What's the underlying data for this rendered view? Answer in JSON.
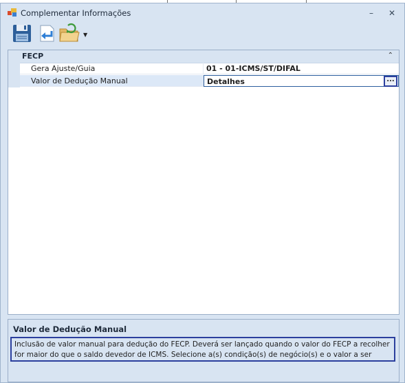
{
  "window": {
    "title": "Complementar Informações",
    "minimize_glyph": "–",
    "close_glyph": "✕"
  },
  "toolbar": {
    "buttons": [
      {
        "icon": "save-icon"
      },
      {
        "icon": "return-icon"
      },
      {
        "icon": "folder-open-icon"
      }
    ],
    "dropdown_glyph": "▼"
  },
  "property_grid": {
    "category": "FECP",
    "collapse_glyph": "⌃",
    "rows": [
      {
        "name": "Gera Ajuste/Guia",
        "value": "01 - 01-ICMS/ST/DIFAL"
      },
      {
        "name": "Valor de Dedução Manual",
        "value": "Detalhes",
        "button": "..."
      }
    ]
  },
  "help": {
    "title": "Valor de Dedução Manual",
    "description": "Inclusão de valor manual para dedução do FECP. Deverá ser lançado quando o valor do FECP a recolher for maior do que o saldo devedor de ICMS. Selecione a(s) condição(s) de negócio(s) e o valor a ser deduzido."
  },
  "colors": {
    "accent_border": "#2b3f9e",
    "window_bg": "#d8e4f2"
  }
}
